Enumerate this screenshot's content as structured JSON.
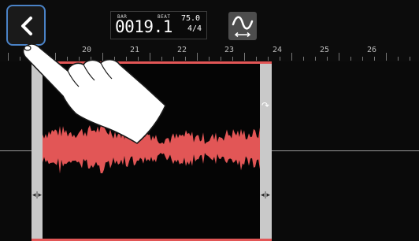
{
  "header": {
    "back_button": {
      "icon": "chevron-left-icon"
    },
    "counter": {
      "bar_label": "BAR",
      "beat_label": "BEAT",
      "position": "0019.1",
      "tempo": "75.0",
      "time_signature": "4/4"
    },
    "stretch_button": {
      "icon": "time-stretch-icon"
    }
  },
  "ruler": {
    "bars": [
      "20",
      "21",
      "22",
      "23",
      "24",
      "25",
      "26"
    ]
  },
  "region": {
    "waveform_color": "#e25656",
    "loop_icon": "loop-arrow-icon",
    "edge_handle_icon": "trim-handle-icon"
  },
  "overlay": {
    "gesture_icon": "tap-hand-icon"
  }
}
